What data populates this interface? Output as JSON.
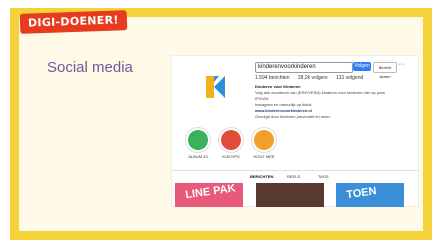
{
  "badge": {
    "label": "DIGI-DOENER!"
  },
  "slide": {
    "title": "Social media"
  },
  "profile": {
    "handle": "kinderenvoorkinderen",
    "follow_label": "Volgen",
    "message_label": "Bericht sturen",
    "more_label": "···",
    "stats": {
      "posts": "1.594 berichten",
      "followers": "28,2k volgers",
      "following": "131 volgend"
    },
    "bio": {
      "name": "Kinderen voor Kinderen",
      "line1": "Volg alle avonturen van (ERK/VERA) kinderen voor kinderen hier op jouw IPG/AN",
      "line2": "Instagram en natuurlijk op tiktok",
      "link": "www.kinderenvoorkinderen.nl",
      "followed_by": "Gevolgd door kinderen preventief en meer"
    }
  },
  "highlights": [
    {
      "label": "ALBUM 43",
      "color": "#3ab25a",
      "icon": "album-icon"
    },
    {
      "label": "KIJKTIPS",
      "color": "#e04b3a",
      "icon": "tv-icon"
    },
    {
      "label": "HOUT MEE",
      "color": "#f2a02a",
      "icon": "heart-icon"
    }
  ],
  "tabs": [
    {
      "label": "BERICHTEN",
      "active": true
    },
    {
      "label": "REELS",
      "active": false
    },
    {
      "label": "TAGS",
      "active": false
    }
  ],
  "posts": [
    {
      "text": "LINE PAK",
      "bg": "#e85a7a"
    },
    {
      "text": "",
      "bg": "#5a3a2e"
    },
    {
      "text": "TOEN",
      "bg": "#3a8fd8"
    }
  ]
}
